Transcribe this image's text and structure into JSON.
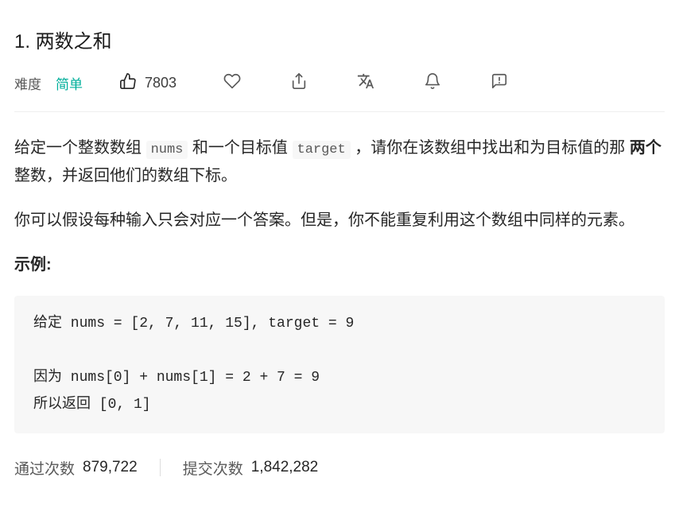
{
  "title": "1. 两数之和",
  "meta": {
    "difficulty_label": "难度",
    "difficulty_value": "简单",
    "likes": "7803"
  },
  "description": {
    "p1_part1": "给定一个整数数组 ",
    "p1_code1": "nums",
    "p1_part2": " 和一个目标值 ",
    "p1_code2": "target",
    "p1_part3": " ，请你在该数组中找出和为目标值的那 ",
    "p1_bold": "两个",
    "p1_part4": " 整数，并返回他们的数组下标。",
    "p2": "你可以假设每种输入只会对应一个答案。但是，你不能重复利用这个数组中同样的元素。",
    "example_label": "示例:",
    "code_block": "给定 nums = [2, 7, 11, 15], target = 9\n\n因为 nums[0] + nums[1] = 2 + 7 = 9\n所以返回 [0, 1]"
  },
  "stats": {
    "accepted_label": "通过次数",
    "accepted_value": "879,722",
    "submissions_label": "提交次数",
    "submissions_value": "1,842,282"
  }
}
